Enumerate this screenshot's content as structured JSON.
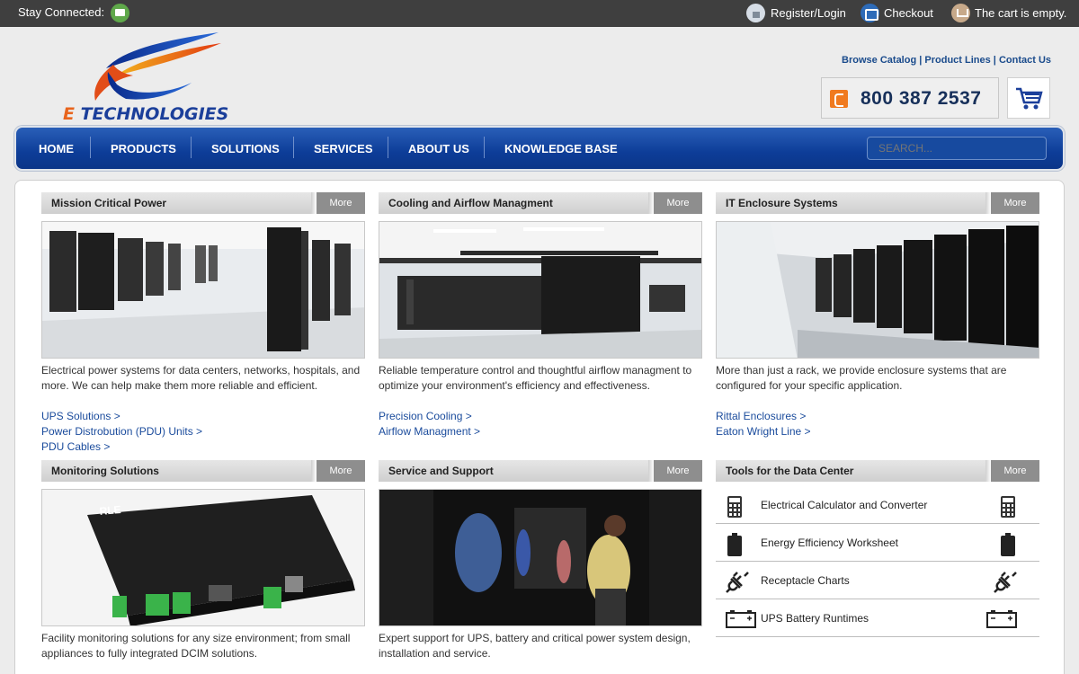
{
  "topbar": {
    "stay_connected": "Stay Connected:",
    "register": "Register/Login",
    "checkout": "Checkout",
    "cart": "The cart is empty."
  },
  "header": {
    "logo_e": "E",
    "logo_text": " TECHNOLOGIES",
    "links": [
      "Browse Catalog",
      "Product Lines",
      "Contact Us"
    ],
    "phone": "800 387 2537"
  },
  "nav": {
    "items": [
      "HOME",
      "PRODUCTS",
      "SOLUTIONS",
      "SERVICES",
      "ABOUT US",
      "KNOWLEDGE BASE"
    ],
    "search_placeholder": "SEARCH..."
  },
  "more_label": "More",
  "panels": [
    {
      "title": "Mission Critical Power",
      "desc": "Electrical power systems for data centers, networks, hospitals, and more. We can help make them more reliable and efficient.",
      "links": [
        "UPS Solutions >",
        "Power Distrobution (PDU) Units >",
        "PDU Cables >"
      ]
    },
    {
      "title": "Cooling and Airflow Managment",
      "desc": "Reliable temperature control and thoughtful airflow managment to optimize your environment's efficiency and effectiveness.",
      "links": [
        "Precision Cooling >",
        "Airflow Managment >"
      ]
    },
    {
      "title": "IT Enclosure Systems",
      "desc": "More than just a rack, we provide enclosure systems that are configured for your specific application.",
      "links": [
        "Rittal Enclosures >",
        "Eaton Wright Line >"
      ]
    },
    {
      "title": "Monitoring Solutions",
      "desc": "Facility monitoring solutions for any size environment; from small appliances to fully integrated DCIM solutions.",
      "links": []
    },
    {
      "title": "Service and Support",
      "desc": "Expert support for UPS, battery and critical power system design, installation and service.",
      "links": []
    }
  ],
  "tools": {
    "title": "Tools for the Data Center",
    "items": [
      {
        "label": "Electrical Calculator and Converter",
        "icon": "calculator-icon"
      },
      {
        "label": "Energy Efficiency Worksheet",
        "icon": "battery-icon"
      },
      {
        "label": "Receptacle Charts",
        "icon": "plug-icon"
      },
      {
        "label": "UPS Battery Runtimes",
        "icon": "car-battery-icon"
      }
    ]
  },
  "device_label": "RLE"
}
